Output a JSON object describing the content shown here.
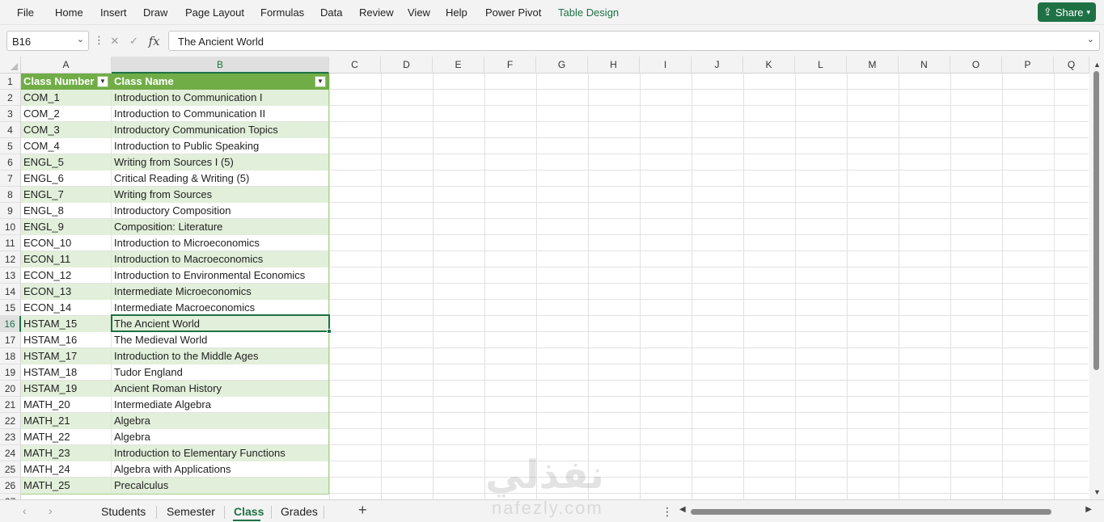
{
  "menu": {
    "items": [
      "File",
      "Home",
      "Insert",
      "Draw",
      "Page Layout",
      "Formulas",
      "Data",
      "Review",
      "View",
      "Help",
      "Power Pivot",
      "Table Design"
    ],
    "active": "Table Design",
    "share_label": "Share"
  },
  "formula_bar": {
    "name_box": "B16",
    "fx_label": "fx",
    "formula": "The Ancient World"
  },
  "columns": [
    "A",
    "B",
    "C",
    "D",
    "E",
    "F",
    "G",
    "H",
    "I",
    "J",
    "K",
    "L",
    "M",
    "N",
    "O",
    "P",
    "Q"
  ],
  "selected_column": "B",
  "selected_row": 16,
  "table": {
    "headers": [
      "Class Number",
      "Class Name"
    ],
    "rows": [
      [
        "COM_1",
        "Introduction to Communication I"
      ],
      [
        "COM_2",
        "Introduction to Communication II"
      ],
      [
        "COM_3",
        "Introductory Communication Topics"
      ],
      [
        "COM_4",
        "Introduction to Public Speaking"
      ],
      [
        "ENGL_5",
        "Writing from Sources I (5)"
      ],
      [
        "ENGL_6",
        "Critical Reading & Writing (5)"
      ],
      [
        "ENGL_7",
        "Writing from Sources"
      ],
      [
        "ENGL_8",
        "Introductory Composition"
      ],
      [
        "ENGL_9",
        "Composition: Literature"
      ],
      [
        "ECON_10",
        "Introduction to Microeconomics"
      ],
      [
        "ECON_11",
        "Introduction to Macroeconomics"
      ],
      [
        "ECON_12",
        "Introduction to Environmental Economics"
      ],
      [
        "ECON_13",
        "Intermediate Microeconomics"
      ],
      [
        "ECON_14",
        "Intermediate Macroeconomics"
      ],
      [
        "HSTAM_15",
        "The Ancient World"
      ],
      [
        "HSTAM_16",
        "The Medieval World"
      ],
      [
        "HSTAM_17",
        "Introduction to the Middle Ages"
      ],
      [
        "HSTAM_18",
        "Tudor England"
      ],
      [
        "HSTAM_19",
        "Ancient Roman History"
      ],
      [
        "MATH_20",
        "Intermediate Algebra"
      ],
      [
        "MATH_21",
        "Algebra"
      ],
      [
        "MATH_22",
        "Algebra"
      ],
      [
        "MATH_23",
        "Introduction to Elementary Functions"
      ],
      [
        "MATH_24",
        "Algebra with Applications"
      ],
      [
        "MATH_25",
        "Precalculus"
      ]
    ]
  },
  "sheets": {
    "tabs": [
      "Students",
      "Semester",
      "Class",
      "Grades"
    ],
    "active": "Class"
  },
  "watermark": {
    "arabic": "نفذلي",
    "latin": "nafezly.com"
  },
  "colors": {
    "accent": "#1e7145",
    "table_header": "#70ad47",
    "band": "#e2efda"
  }
}
